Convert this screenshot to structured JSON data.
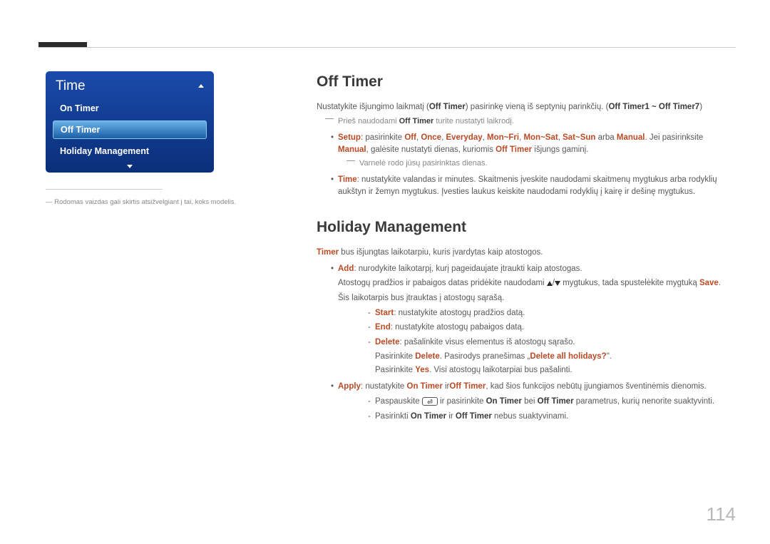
{
  "page_number": "114",
  "panel": {
    "title": "Time",
    "items": [
      "On Timer",
      "Off Timer",
      "Holiday Management"
    ],
    "highlighted_index": 1,
    "note_prefix": "―",
    "note": "Rodomas vaizdas gali skirtis atsižvelgiant į tai, koks modelis."
  },
  "sections": {
    "off_timer": {
      "heading": "Off Timer",
      "intro_pre": "Nustatykite išjungimo laikmatį (",
      "intro_b1": "Off Timer",
      "intro_mid": ") pasirinkę vieną iš septynių parinkčių. (",
      "intro_b2": "Off Timer1 ~ Off Timer7",
      "intro_post": ")",
      "note_pre": "Prieš naudodami ",
      "note_b": "Off Timer",
      "note_post": " turite nustatyti laikrodį.",
      "setup_label": "Setup",
      "setup_text1": ": pasirinkite ",
      "setup_opts": [
        "Off",
        "Once",
        "Everyday",
        "Mon~Fri",
        "Mon~Sat",
        "Sat~Sun"
      ],
      "setup_or": " arba ",
      "setup_manual": "Manual",
      "setup_text2": ". Jei pasirinksite ",
      "setup_text3": ", galėsite nustatyti dienas, kuriomis ",
      "setup_b2": "Off Timer",
      "setup_text4": " išjungs gaminį.",
      "check_note": "Varnelė rodo jūsų pasirinktas dienas.",
      "time_label": "Time",
      "time_text": ": nustatykite valandas ir minutes. Skaitmenis įveskite naudodami skaitmenų mygtukus arba rodyklių aukštyn ir žemyn mygtukus. Įvesties laukus keiskite naudodami rodyklių į kairę ir dešinę mygtukus."
    },
    "holiday": {
      "heading": "Holiday Management",
      "intro_b": "Timer",
      "intro_text": " bus išjungtas laikotarpiu, kuris įvardytas kaip atostogos.",
      "add_label": "Add",
      "add_text": ": nurodykite laikotarpį, kurį pageidaujate įtraukti kaip atostogas.",
      "add_line2_pre": "Atostogų pradžios ir pabaigos datas pridėkite naudodami ",
      "add_line2_post": " mygtukus, tada spustelėkite mygtuką ",
      "save": "Save",
      "add_line3": "Šis laikotarpis bus įtrauktas į atostogų sąrašą.",
      "start_label": "Start",
      "start_text": ": nustatykite atostogų pradžios datą.",
      "end_label": "End",
      "end_text": ": nustatykite atostogų pabaigos datą.",
      "delete_label": "Delete",
      "delete_text": ": pašalinkite visus elementus iš atostogų sąrašo.",
      "delete_line2_pre": "Pasirinkite ",
      "delete_b": "Delete",
      "delete_line2_mid": ". Pasirodys pranešimas „",
      "delete_q": "Delete all holidays?",
      "delete_line2_post": "\".",
      "delete_line3_pre": "Pasirinkite ",
      "yes": "Yes",
      "delete_line3_post": ". Visi atostogų laikotarpiai bus pašalinti.",
      "apply_label": "Apply",
      "apply_text1": ": nustatykite ",
      "apply_on": "On Timer",
      "apply_mid": " ir",
      "apply_off": "Off Timer",
      "apply_text2": ", kad šios funkcijos nebūtų įjungiamos šventinėmis dienomis.",
      "apply_sub1_pre": "Paspauskite ",
      "apply_sub1_mid1": " ir pasirinkite ",
      "apply_sub1_mid2": " bei ",
      "apply_sub1_post": " parametrus, kurių nenorite suaktyvinti.",
      "apply_sub2_pre": "Pasirinkti ",
      "apply_sub2_mid": " ir ",
      "apply_sub2_post": " nebus suaktyvinami."
    }
  }
}
